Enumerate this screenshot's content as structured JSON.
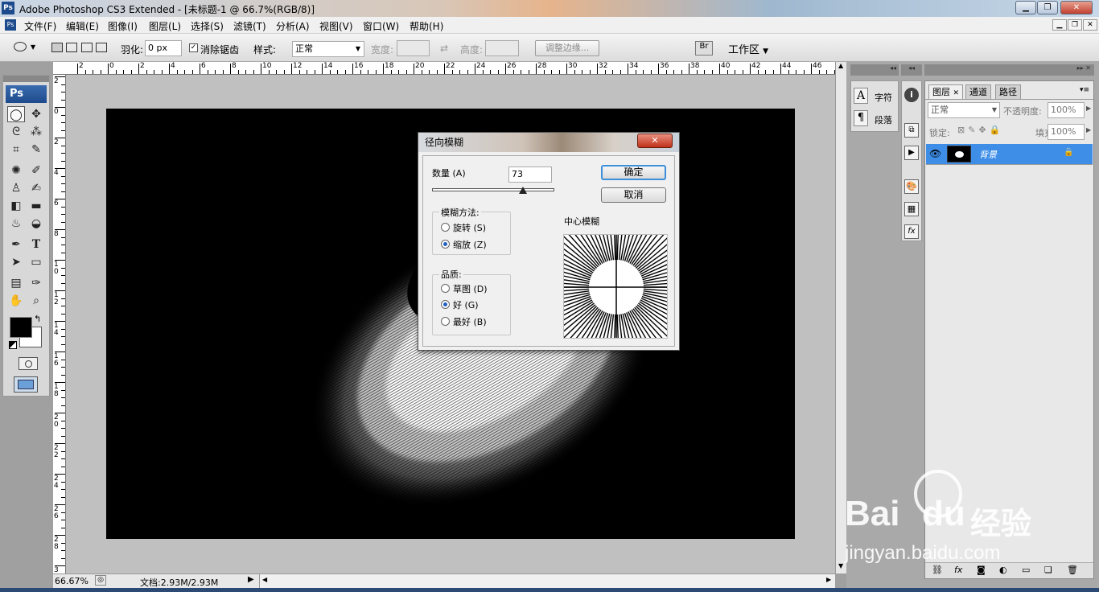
{
  "app": {
    "title": "Adobe Photoshop CS3 Extended - [未标题-1 @ 66.7%(RGB/8)]",
    "logo": "Ps"
  },
  "menu": [
    "文件(F)",
    "编辑(E)",
    "图像(I)",
    "图层(L)",
    "选择(S)",
    "滤镜(T)",
    "分析(A)",
    "视图(V)",
    "窗口(W)",
    "帮助(H)"
  ],
  "options": {
    "feather_label": "羽化:",
    "feather_value": "0 px",
    "antialias_label": "消除锯齿",
    "antialias_checked": true,
    "style_label": "样式:",
    "style_value": "正常",
    "width_label": "宽度:",
    "height_label": "高度:",
    "refine_button": "调整边缘...",
    "workspace_button": "工作区"
  },
  "toolbox": {
    "logo": "Ps"
  },
  "rulers": {
    "h_numbers": [
      "2",
      "0",
      "2",
      "4",
      "6",
      "8",
      "10",
      "12",
      "14",
      "16",
      "18",
      "20",
      "22",
      "24",
      "26",
      "28",
      "30",
      "32",
      "34",
      "36",
      "38",
      "40",
      "42",
      "44",
      "46"
    ],
    "v_numbers": [
      "2",
      "0",
      "2",
      "4",
      "6",
      "8",
      "1\n0",
      "1\n2",
      "1\n4",
      "1\n6",
      "1\n8",
      "2\n0",
      "2\n2",
      "2\n4",
      "2\n6",
      "2\n8",
      "3"
    ]
  },
  "status": {
    "zoom": "66.67%",
    "doc_info": "文档:2.93M/2.93M"
  },
  "dialog": {
    "title": "径向模糊",
    "amount_label": "数量 (A)",
    "amount_value": "73",
    "amount_fraction": 0.73,
    "method_label": "模糊方法:",
    "method_spin": "旋转 (S)",
    "method_zoom": "缩放 (Z)",
    "method_selected": "zoom",
    "quality_label": "品质:",
    "quality_draft": "草图 (D)",
    "quality_good": "好 (G)",
    "quality_best": "最好 (B)",
    "quality_selected": "good",
    "center_label": "中心模糊",
    "ok": "确定",
    "cancel": "取消"
  },
  "char_panel": {
    "char_label": "字符",
    "para_label": "段落"
  },
  "layers_panel": {
    "tabs": [
      "图层",
      "通道",
      "路径"
    ],
    "blend_mode": "正常",
    "opacity_label": "不透明度:",
    "opacity_value": "100%",
    "lock_label": "锁定:",
    "fill_label": "填充:",
    "fill_value": "100%",
    "layer_name": "背景"
  },
  "watermark": {
    "brand": "Bai",
    "brand2": "du",
    "cn": "经验",
    "url": "jingyan.baidu.com"
  },
  "colors": {
    "accent": "#3e8ee8",
    "ps_blue": "#1d4a8c",
    "foreground": "#000000",
    "background": "#ffffff"
  }
}
